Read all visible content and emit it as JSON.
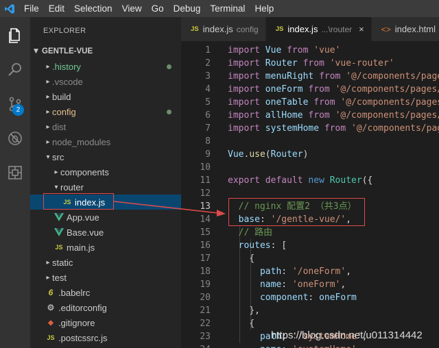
{
  "menu": [
    "File",
    "Edit",
    "Selection",
    "View",
    "Go",
    "Debug",
    "Terminal",
    "Help"
  ],
  "activity": {
    "scm_badge": "2"
  },
  "sidebar": {
    "title": "EXPLORER",
    "project": "GENTLE-VUE",
    "items": [
      {
        "label": ".history",
        "icon": "folder",
        "color": "#73c991"
      },
      {
        "label": ".vscode",
        "icon": "folder",
        "color": "#8c8c8c"
      },
      {
        "label": "build",
        "icon": "folder",
        "color": "#cccccc"
      },
      {
        "label": "config",
        "icon": "folder",
        "color": "#e2c08d"
      },
      {
        "label": "dist",
        "icon": "folder",
        "color": "#8c8c8c"
      },
      {
        "label": "node_modules",
        "icon": "folder",
        "color": "#8c8c8c"
      },
      {
        "label": "src",
        "icon": "folder-open",
        "color": "#cccccc"
      },
      {
        "label": "components",
        "icon": "folder",
        "color": "#cccccc"
      },
      {
        "label": "router",
        "icon": "folder-open",
        "color": "#cccccc"
      },
      {
        "label": "index.js",
        "icon": "JS",
        "color": "#ffffff"
      },
      {
        "label": "App.vue",
        "icon": "V",
        "color": "#cccccc"
      },
      {
        "label": "Base.vue",
        "icon": "V",
        "color": "#cccccc"
      },
      {
        "label": "main.js",
        "icon": "JS",
        "color": "#cccccc"
      },
      {
        "label": "static",
        "icon": "folder",
        "color": "#cccccc"
      },
      {
        "label": "test",
        "icon": "folder",
        "color": "#cccccc"
      },
      {
        "label": ".babelrc",
        "icon": "6",
        "color": "#cccccc"
      },
      {
        "label": ".editorconfig",
        "icon": "gear",
        "color": "#cccccc"
      },
      {
        "label": ".gitignore",
        "icon": "git",
        "color": "#cccccc"
      },
      {
        "label": ".postcssrc.js",
        "icon": "JS",
        "color": "#cccccc"
      }
    ]
  },
  "tabs": [
    {
      "label": "index.js",
      "desc": "config",
      "icon": "JS"
    },
    {
      "label": "index.js",
      "desc": "...\\router",
      "icon": "JS",
      "active": true,
      "close": "×"
    },
    {
      "label": "index.html",
      "desc": "",
      "icon": "<>"
    }
  ],
  "editor": {
    "current_line": 13,
    "lines": [
      [
        [
          "kw2",
          "import"
        ],
        [
          "pl",
          " "
        ],
        [
          "var",
          "Vue"
        ],
        [
          "pl",
          " "
        ],
        [
          "kw2",
          "from"
        ],
        [
          "pl",
          " "
        ],
        [
          "str",
          "'vue'"
        ]
      ],
      [
        [
          "kw2",
          "import"
        ],
        [
          "pl",
          " "
        ],
        [
          "var",
          "Router"
        ],
        [
          "pl",
          " "
        ],
        [
          "kw2",
          "from"
        ],
        [
          "pl",
          " "
        ],
        [
          "str",
          "'vue-router'"
        ]
      ],
      [
        [
          "kw2",
          "import"
        ],
        [
          "pl",
          " "
        ],
        [
          "var",
          "menuRight"
        ],
        [
          "pl",
          " "
        ],
        [
          "kw2",
          "from"
        ],
        [
          "pl",
          " "
        ],
        [
          "str",
          "'@/components/pages/"
        ]
      ],
      [
        [
          "kw2",
          "import"
        ],
        [
          "pl",
          " "
        ],
        [
          "var",
          "oneForm"
        ],
        [
          "pl",
          " "
        ],
        [
          "kw2",
          "from"
        ],
        [
          "pl",
          " "
        ],
        [
          "str",
          "'@/components/pages/"
        ]
      ],
      [
        [
          "kw2",
          "import"
        ],
        [
          "pl",
          " "
        ],
        [
          "var",
          "oneTable"
        ],
        [
          "pl",
          " "
        ],
        [
          "kw2",
          "from"
        ],
        [
          "pl",
          " "
        ],
        [
          "str",
          "'@/components/pages"
        ]
      ],
      [
        [
          "kw2",
          "import"
        ],
        [
          "pl",
          " "
        ],
        [
          "var",
          "allHome"
        ],
        [
          "pl",
          " "
        ],
        [
          "kw2",
          "from"
        ],
        [
          "pl",
          " "
        ],
        [
          "str",
          "'@/components/pages/"
        ]
      ],
      [
        [
          "kw2",
          "import"
        ],
        [
          "pl",
          " "
        ],
        [
          "var",
          "systemHome"
        ],
        [
          "pl",
          " "
        ],
        [
          "kw2",
          "from"
        ],
        [
          "pl",
          " "
        ],
        [
          "str",
          "'@/components/pag"
        ]
      ],
      [],
      [
        [
          "var",
          "Vue"
        ],
        [
          "pl",
          "."
        ],
        [
          "fn",
          "use"
        ],
        [
          "pl",
          "("
        ],
        [
          "var",
          "Router"
        ],
        [
          "pl",
          ")"
        ]
      ],
      [],
      [
        [
          "kw2",
          "export"
        ],
        [
          "pl",
          " "
        ],
        [
          "kw2",
          "default"
        ],
        [
          "pl",
          " "
        ],
        [
          "kw",
          "new"
        ],
        [
          "pl",
          " "
        ],
        [
          "cls",
          "Router"
        ],
        [
          "pl",
          "({"
        ]
      ],
      [],
      [
        [
          "pl",
          "  "
        ],
        [
          "cmt",
          "// nginx 配置2 （共3点）"
        ]
      ],
      [
        [
          "pl",
          "  "
        ],
        [
          "var",
          "base"
        ],
        [
          "pl",
          ": "
        ],
        [
          "str",
          "'/gentle-vue/'"
        ],
        [
          "pl",
          ","
        ]
      ],
      [
        [
          "pl",
          "  "
        ],
        [
          "cmt",
          "// 路由"
        ]
      ],
      [
        [
          "pl",
          "  "
        ],
        [
          "var",
          "routes"
        ],
        [
          "pl",
          ": ["
        ]
      ],
      [
        [
          "pl",
          "    {"
        ]
      ],
      [
        [
          "pl",
          "      "
        ],
        [
          "var",
          "path"
        ],
        [
          "pl",
          ": "
        ],
        [
          "str",
          "'/oneForm'"
        ],
        [
          "pl",
          ","
        ]
      ],
      [
        [
          "pl",
          "      "
        ],
        [
          "var",
          "name"
        ],
        [
          "pl",
          ": "
        ],
        [
          "str",
          "'oneForm'"
        ],
        [
          "pl",
          ","
        ]
      ],
      [
        [
          "pl",
          "      "
        ],
        [
          "var",
          "component"
        ],
        [
          "pl",
          ": "
        ],
        [
          "var",
          "oneForm"
        ]
      ],
      [
        [
          "pl",
          "    },"
        ]
      ],
      [
        [
          "pl",
          "    {"
        ]
      ],
      [
        [
          "pl",
          "      "
        ],
        [
          "var",
          "path"
        ],
        [
          "pl",
          ": "
        ],
        [
          "str",
          "'/systemHome'"
        ],
        [
          "pl",
          ","
        ]
      ],
      [
        [
          "pl",
          "      "
        ],
        [
          "var",
          "name"
        ],
        [
          "pl",
          ": "
        ],
        [
          "str",
          "'systemHome'"
        ],
        [
          "pl",
          ","
        ]
      ]
    ]
  },
  "watermark": "https://blog.csdn.net/u011314442",
  "colors": {
    "accent": "#007acc",
    "annotation": "#e04a4a"
  }
}
